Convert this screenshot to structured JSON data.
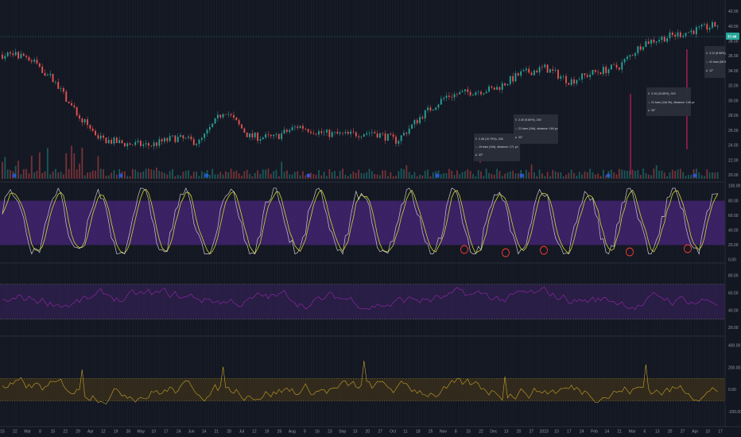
{
  "colors": {
    "background": "#131722",
    "grid": "#2a2e39",
    "up": "#26a69a",
    "down": "#ef5350",
    "stoch_k": "#c9c9c9",
    "stoch_d": "#d6d62a",
    "stoch_band": "#5a2a99",
    "rsi_line": "#9c27b0",
    "rsi_band": "#3d2366",
    "cci_line": "#c9a227",
    "cci_band": "#4a3b18",
    "marker": "#ff3b30",
    "price_tag": "#26a69a",
    "tooltip_bg": "#2a2e39"
  },
  "price_axis": {
    "ticks": [
      "42.00",
      "40.00",
      "38.00",
      "36.00",
      "34.00",
      "32.00",
      "30.00",
      "28.00",
      "26.00",
      "24.00",
      "22.00",
      "20.00"
    ],
    "last_price": "37.46"
  },
  "stoch_axis": {
    "ticks": [
      "100.00",
      "80.00",
      "60.00",
      "40.00",
      "20.00",
      "0.00"
    ]
  },
  "rsi_axis": {
    "ticks": [
      "80.00",
      "60.00",
      "40.00",
      "20.00"
    ]
  },
  "cci_axis": {
    "ticks": [
      "400.00",
      "200.00",
      "0.00",
      "-200.00"
    ]
  },
  "time_axis": {
    "labels": [
      "15",
      "22",
      "Mar",
      "8",
      "15",
      "22",
      "29",
      "Apr",
      "12",
      "19",
      "26",
      "May",
      "10",
      "17",
      "24",
      "Jun",
      "14",
      "21",
      "28",
      "Jul",
      "12",
      "19",
      "26",
      "Aug",
      "9",
      "16",
      "23",
      "Sep",
      "13",
      "20",
      "27",
      "Oct",
      "11",
      "18",
      "25",
      "Nov",
      "8",
      "15",
      "22",
      "Dec",
      "13",
      "20",
      "27",
      "2023",
      "10",
      "17",
      "24",
      "Feb",
      "14",
      "21",
      "Mar",
      "6",
      "13",
      "20",
      "27",
      "Apr",
      "10",
      "17"
    ]
  },
  "tooltips": [
    {
      "line1": "2.46 (10.75%), 246",
      "line2": "19 bars (19d), distance: 171 px",
      "line3": "43°"
    },
    {
      "line1": "2.40 (9.80%), 240",
      "line2": "21 bars (19d), distance: 184 px",
      "line3": "33°"
    },
    {
      "line1": "3.19 (10.65%), 319",
      "line2": "21 bars (14d 9h), distance: 146 px",
      "line3": "39°"
    },
    {
      "line1": "3.12 (8.98%), ",
      "line2": "41 bars (58.5",
      "line3": "12°"
    }
  ],
  "chart_data": [
    {
      "type": "candlestick",
      "title": "",
      "xlabel": "",
      "ylabel": "",
      "ylim": [
        19.5,
        43
      ],
      "grid": true,
      "legend": "none",
      "description_points": {
        "x": [
          "Feb 15",
          "Feb 22",
          "Mar 1",
          "Mar 8",
          "Mar 15",
          "Mar 29",
          "Apr 12",
          "May 1",
          "May 17",
          "Jun 1",
          "Jun 21",
          "Jul 12",
          "Aug 1",
          "Aug 23",
          "Sep 13",
          "Oct 1",
          "Oct 18",
          "Nov 1",
          "Nov 15",
          "Dec 1",
          "Dec 20",
          "2023",
          "Jan 17",
          "Feb 1",
          "Feb 14",
          "Mar 1",
          "Mar 13",
          "Mar 27",
          "Apr 10",
          "Apr 17"
        ],
        "close": [
          36.2,
          36.0,
          33.0,
          28.2,
          24.8,
          24.2,
          24.0,
          25.0,
          24.4,
          28.8,
          25.2,
          25.0,
          26.6,
          25.6,
          25.4,
          25.8,
          24.6,
          28.0,
          30.6,
          31.2,
          31.6,
          33.6,
          34.4,
          32.6,
          33.8,
          34.6,
          37.8,
          38.6,
          39.4,
          40.2
        ]
      }
    },
    {
      "type": "line",
      "title": "",
      "ylim": [
        0,
        100
      ],
      "bands": [
        20,
        80
      ],
      "marked_oversold_points": 6
    },
    {
      "type": "line",
      "title": "",
      "ylim": [
        15,
        90
      ],
      "bands": [
        30,
        70
      ]
    },
    {
      "type": "line",
      "title": "",
      "ylim": [
        -300,
        450
      ],
      "bands": [
        -100,
        100
      ]
    }
  ]
}
